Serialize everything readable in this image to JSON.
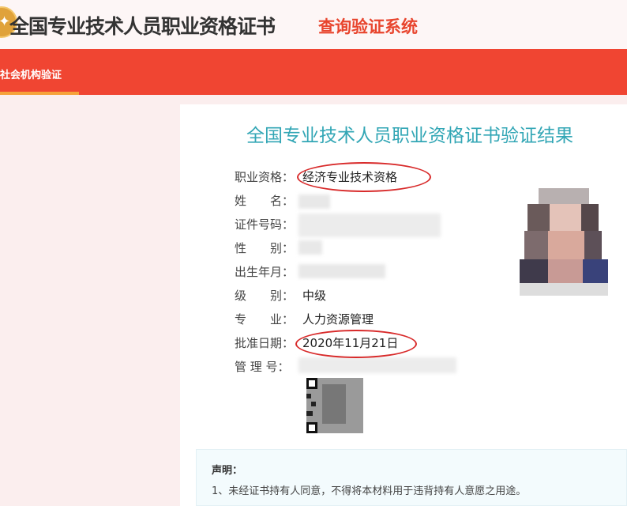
{
  "header": {
    "title_main": "全国专业技术人员职业资格证书",
    "title_sub": "查询验证系统",
    "logo_icon": "gold-emblem-icon"
  },
  "nav": {
    "items": [
      {
        "label": "社会机构验证",
        "active": true
      }
    ],
    "accent_color": "#f04532",
    "active_underline_color": "#f6a23a"
  },
  "result": {
    "title": "全国专业技术人员职业资格证书验证结果",
    "fields": [
      {
        "label": "职业资格：",
        "value": "经济专业技术资格"
      },
      {
        "label": "姓　　名：",
        "value": ""
      },
      {
        "label": "证件号码：",
        "value": ""
      },
      {
        "label": "性　　别：",
        "value": ""
      },
      {
        "label": "出生年月：",
        "value": ""
      },
      {
        "label": "级　　别：",
        "value": "中级"
      },
      {
        "label": "专　　业：",
        "value": "人力资源管理"
      },
      {
        "label": "批准日期：",
        "value": "2020年11月21日"
      },
      {
        "label": "管 理 号：",
        "value": ""
      }
    ]
  },
  "notice": {
    "title": "声明：",
    "lines": [
      "1、未经证书持有人同意，不得将本材料用于违背持有人意愿之用途。"
    ]
  },
  "colors": {
    "title_teal": "#32a6b5",
    "highlight_ring": "#d82a2a"
  }
}
